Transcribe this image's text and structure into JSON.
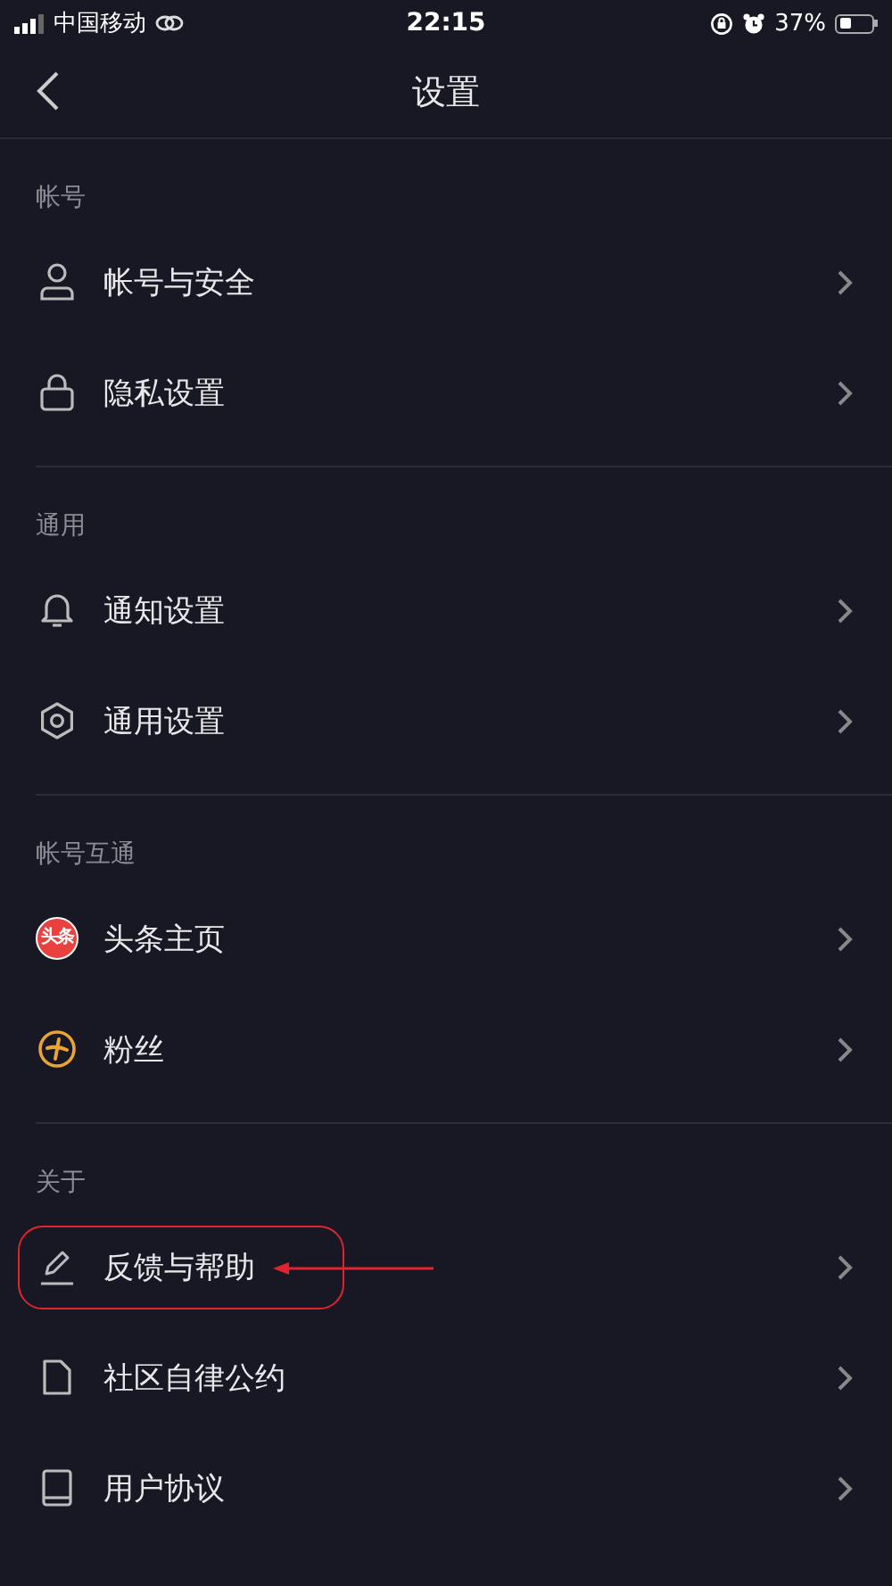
{
  "status_bar": {
    "carrier": "中国移动",
    "time": "22:15",
    "battery_text": "37%"
  },
  "nav": {
    "title": "设置"
  },
  "sections": [
    {
      "header": "帐号",
      "items": [
        {
          "label": "帐号与安全",
          "highlighted": false
        },
        {
          "label": "隐私设置",
          "highlighted": false
        }
      ]
    },
    {
      "header": "通用",
      "items": [
        {
          "label": "通知设置",
          "highlighted": false
        },
        {
          "label": "通用设置",
          "highlighted": false
        }
      ]
    },
    {
      "header": "帐号互通",
      "items": [
        {
          "icon_text": "头条",
          "label": "头条主页",
          "highlighted": false
        },
        {
          "label": "粉丝",
          "highlighted": false
        }
      ]
    },
    {
      "header": "关于",
      "items": [
        {
          "label": "反馈与帮助",
          "highlighted": true
        },
        {
          "label": "社区自律公约",
          "highlighted": false
        },
        {
          "label": "用户协议",
          "highlighted": false
        }
      ]
    }
  ]
}
